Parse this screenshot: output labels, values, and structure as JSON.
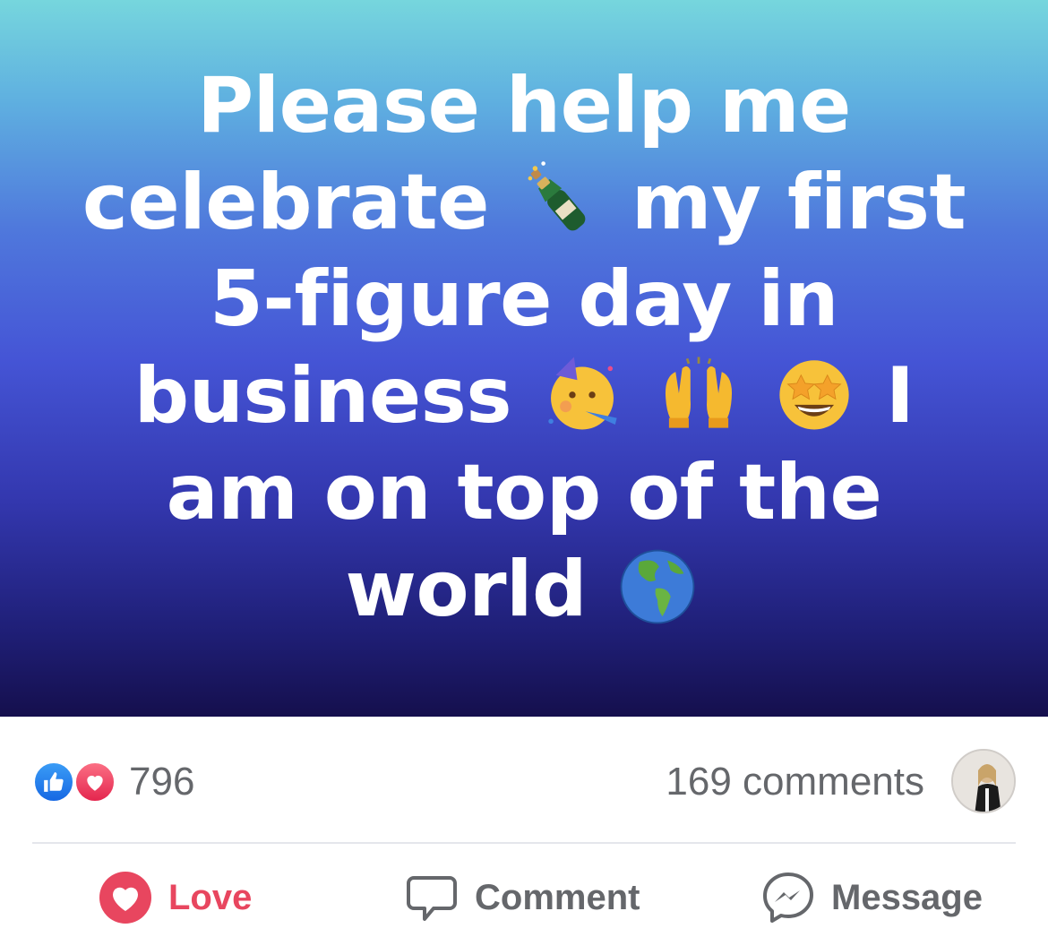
{
  "post": {
    "text_segments": {
      "s1": "Please help me celebrate",
      "s2": "my first 5-figure day in business",
      "s3": "I am on top of the world"
    },
    "emojis": [
      "bottle-with-popping-cork",
      "partying-face",
      "raising-hands",
      "star-struck",
      "globe-americas"
    ],
    "gradient_colors": [
      "#76d6dd",
      "#4f78dc",
      "#3337ae",
      "#150f4d"
    ]
  },
  "stats": {
    "reaction_count": "796",
    "comments_label": "169 comments",
    "reaction_icons": [
      "like-icon",
      "love-icon"
    ]
  },
  "actions": {
    "love_label": "Love",
    "comment_label": "Comment",
    "message_label": "Message"
  },
  "colors": {
    "love_red": "#e8465f",
    "like_blue": "#1b74e4",
    "muted_text": "#65676b"
  }
}
